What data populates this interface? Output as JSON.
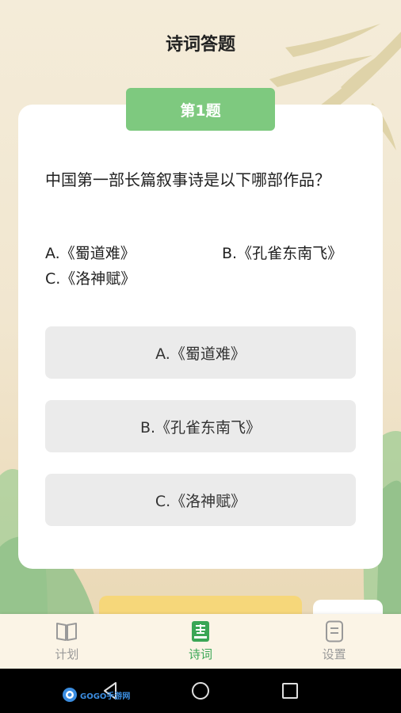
{
  "header": {
    "title": "诗词答题"
  },
  "quiz": {
    "badge": "第1题",
    "question": "中国第一部长篇叙事诗是以下哪部作品？",
    "options": [
      "A.《蜀道难》",
      "B.《孔雀东南飞》",
      "C.《洛神赋》"
    ],
    "answers": [
      "A.《蜀道难》",
      "B.《孔雀东南飞》",
      "C.《洛神赋》"
    ]
  },
  "tabs": [
    {
      "label": "计划",
      "icon": "book-icon",
      "active": false
    },
    {
      "label": "诗词",
      "icon": "poem-answer-icon",
      "active": true
    },
    {
      "label": "设置",
      "icon": "document-icon",
      "active": false
    }
  ],
  "watermark": {
    "text": "GOGO手游网"
  },
  "colors": {
    "accent": "#7ec97f",
    "active_tab": "#3aa655",
    "yellow": "#f6d77a"
  }
}
